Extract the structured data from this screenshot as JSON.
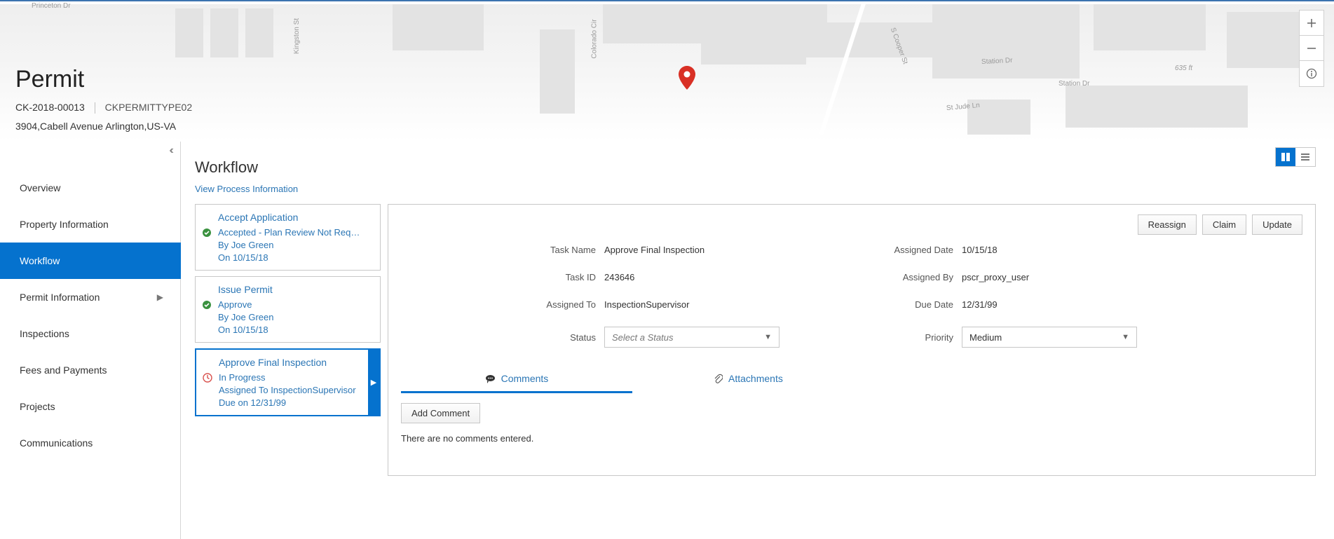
{
  "header": {
    "title": "Permit",
    "record_id": "CK-2018-00013",
    "type_code": "CKPERMITTYPE02",
    "address": "3904,Cabell Avenue Arlington,US-VA",
    "map": {
      "scale_label": "635 ft",
      "street_labels": [
        "Colorado Cir",
        "Kingston St",
        "S Cooper St",
        "Station Dr",
        "Station  Dr",
        "St Jude Ln",
        "Princeton Dr"
      ]
    }
  },
  "sidebar": {
    "items": [
      {
        "label": "Overview"
      },
      {
        "label": "Property Information"
      },
      {
        "label": "Workflow"
      },
      {
        "label": "Permit Information",
        "has_children": true
      },
      {
        "label": "Inspections"
      },
      {
        "label": "Fees and Payments"
      },
      {
        "label": "Projects"
      },
      {
        "label": "Communications"
      }
    ]
  },
  "workflow": {
    "section_title": "Workflow",
    "process_link": "View Process Information",
    "tasks": [
      {
        "title": "Accept Application",
        "status_line": "Accepted - Plan Review Not Req…",
        "by_line": "By Joe Green",
        "date_line": "On 10/15/18",
        "status_kind": "done"
      },
      {
        "title": "Issue Permit",
        "status_line": "Approve",
        "by_line": "By Joe Green",
        "date_line": "On 10/15/18",
        "status_kind": "done"
      },
      {
        "title": "Approve Final Inspection",
        "status_line": "In Progress",
        "by_line": "Assigned To InspectionSupervisor",
        "date_line": "Due on 12/31/99",
        "status_kind": "pending"
      }
    ]
  },
  "detail": {
    "actions": {
      "reassign": "Reassign",
      "claim": "Claim",
      "update": "Update"
    },
    "fields": {
      "task_name": {
        "label": "Task Name",
        "value": "Approve Final Inspection"
      },
      "assigned_date": {
        "label": "Assigned Date",
        "value": "10/15/18"
      },
      "task_id": {
        "label": "Task ID",
        "value": "243646"
      },
      "assigned_by": {
        "label": "Assigned By",
        "value": "pscr_proxy_user"
      },
      "assigned_to": {
        "label": "Assigned To",
        "value": "InspectionSupervisor"
      },
      "due_date": {
        "label": "Due Date",
        "value": "12/31/99"
      },
      "status": {
        "label": "Status",
        "placeholder": "Select a Status"
      },
      "priority": {
        "label": "Priority",
        "value": "Medium"
      }
    },
    "tabs": {
      "comments": "Comments",
      "attachments": "Attachments"
    },
    "add_comment_btn": "Add Comment",
    "no_comments_msg": "There are no comments entered."
  }
}
